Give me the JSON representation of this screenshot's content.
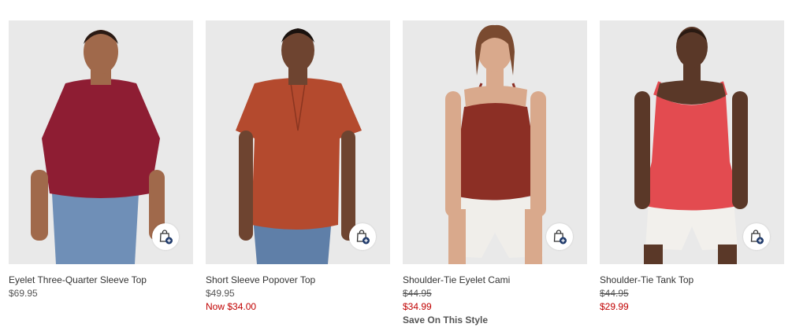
{
  "colors": {
    "photo_bg": "#e9e9e9",
    "sale": "#c00000",
    "text": "#333333",
    "bag_icon_badge": "#1f3a6b"
  },
  "products": [
    {
      "name": "Eyelet Three-Quarter Sleeve Top",
      "price": "$69.95",
      "garment_color": "#8e1d33",
      "bottom_color": "#6f8fb7",
      "skin_color": "#a0694b",
      "icon": "add-to-bag-icon"
    },
    {
      "name": "Short Sleeve Popover Top",
      "price": "$49.95",
      "sale_price": "Now $34.00",
      "garment_color": "#b44a2e",
      "bottom_color": "#5f7fa8",
      "skin_color": "#6e4430",
      "icon": "add-to-bag-icon"
    },
    {
      "name": "Shoulder-Tie Eyelet Cami",
      "original_price": "$44.95",
      "sale_price": "$34.99",
      "promo": "Save On This Style",
      "garment_color": "#8c2f25",
      "bottom_color": "#f0eeea",
      "skin_color": "#d9a98c",
      "icon": "add-to-bag-icon"
    },
    {
      "name": "Shoulder-Tie Tank Top",
      "original_price": "$44.95",
      "sale_price": "$29.99",
      "garment_color": "#e34b50",
      "bottom_color": "#f2f0ec",
      "skin_color": "#5a3828",
      "icon": "add-to-bag-icon"
    }
  ]
}
